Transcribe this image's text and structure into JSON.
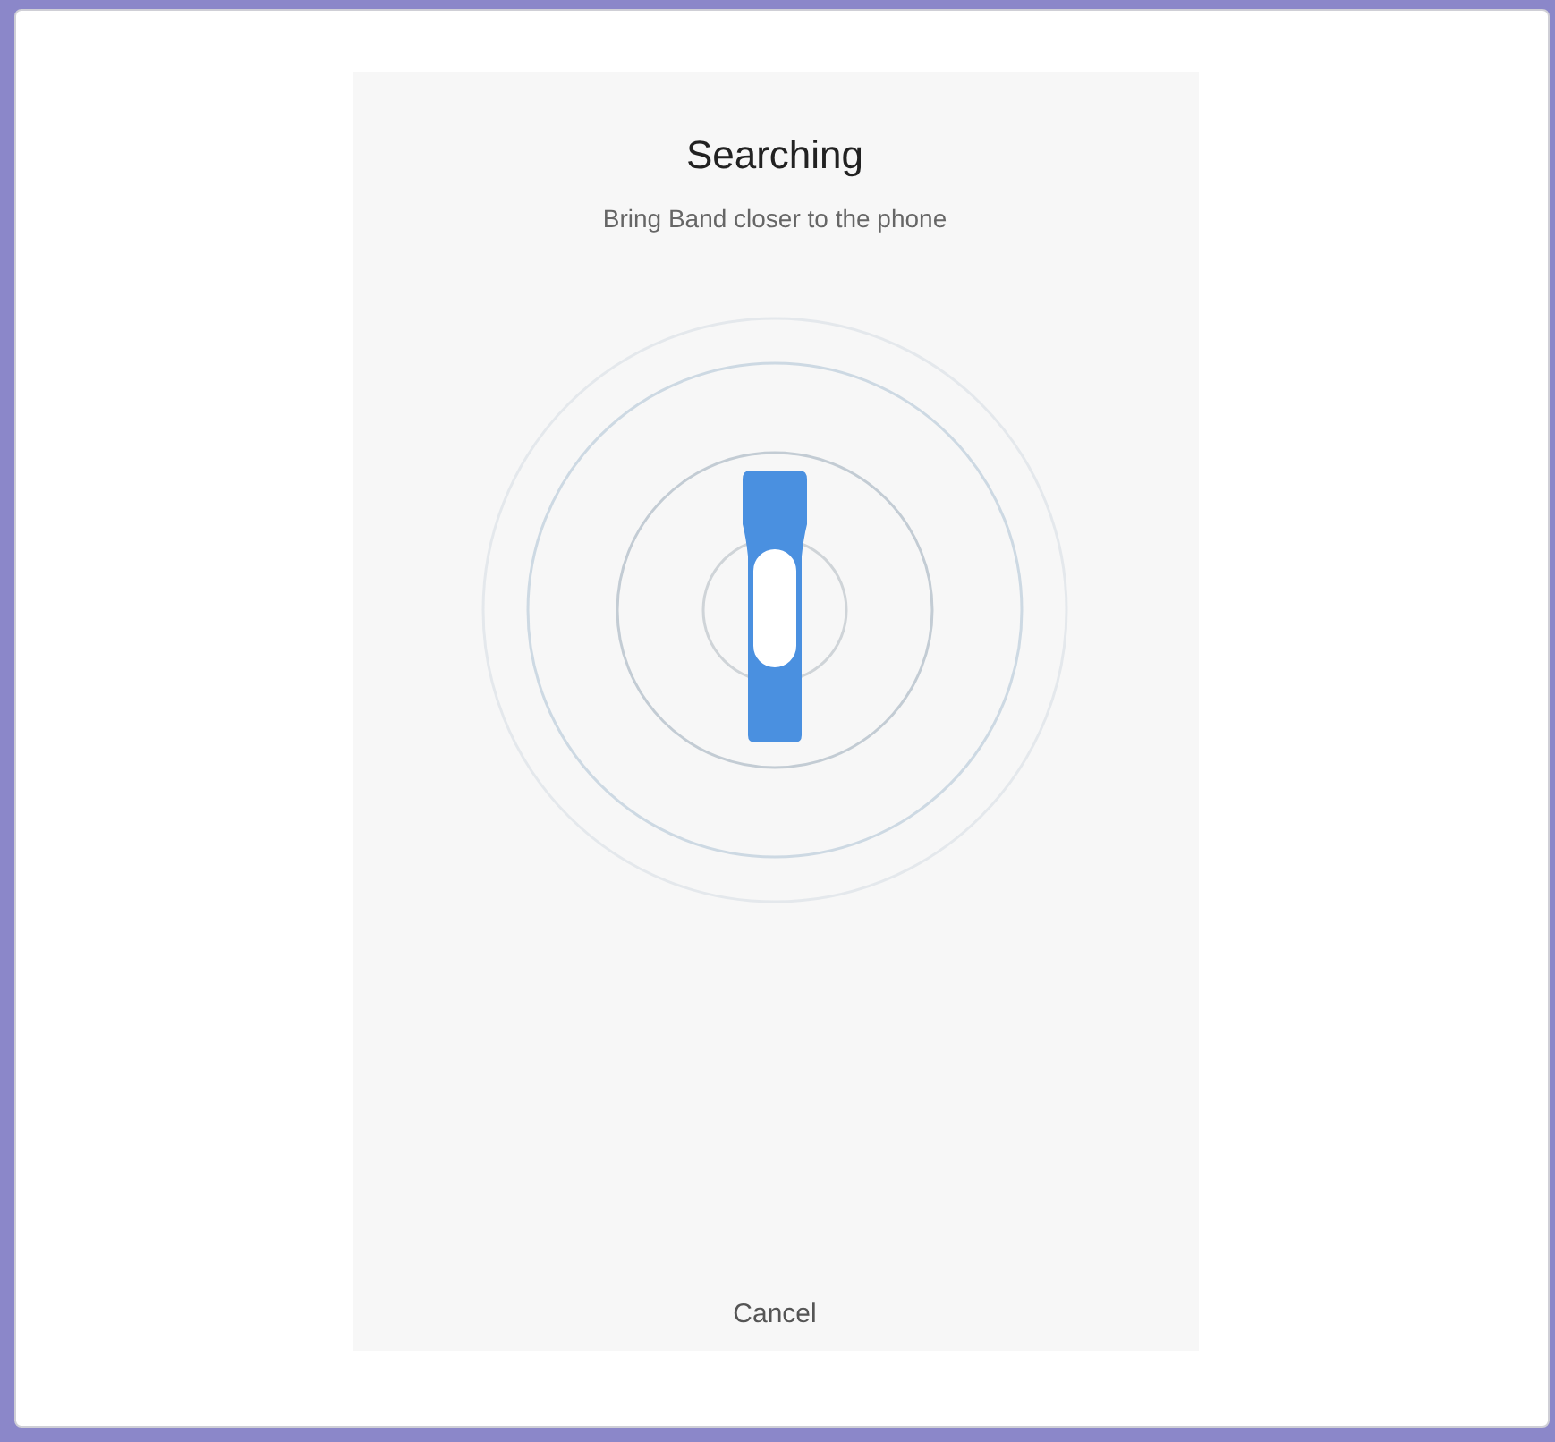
{
  "screen": {
    "title": "Searching",
    "subtitle": "Bring Band closer to the phone"
  },
  "cancel_button": {
    "label": "Cancel"
  }
}
